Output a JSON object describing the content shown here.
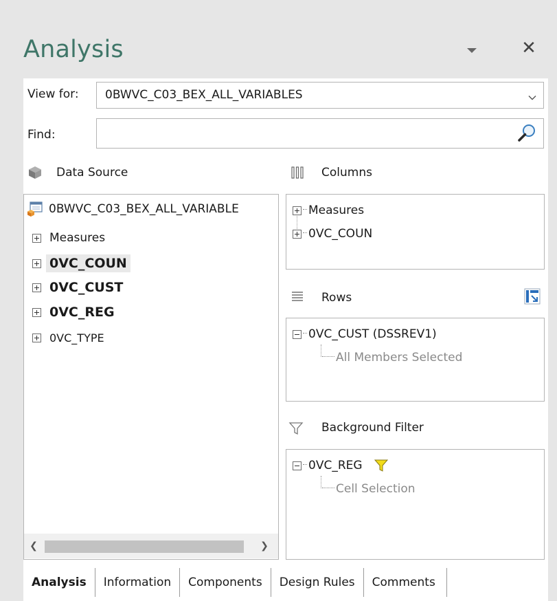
{
  "pane": {
    "title": "Analysis",
    "menu_icon": "dropdown-triangle-icon",
    "close_icon": "close-x-icon"
  },
  "view_for": {
    "label": "View for:",
    "value": "0BWVC_C03_BEX_ALL_VARIABLES"
  },
  "find": {
    "label": "Find:",
    "value": "",
    "icon": "magnifier-icon"
  },
  "data_source": {
    "title": "Data Source",
    "root": "0BWVC_C03_BEX_ALL_VARIABLE",
    "items": [
      {
        "label": "Measures",
        "bold": false
      },
      {
        "label": "0VC_COUN",
        "bold": true,
        "selected": true
      },
      {
        "label": "0VC_CUST",
        "bold": true
      },
      {
        "label": "0VC_REG",
        "bold": true
      },
      {
        "label": "0VC_TYPE",
        "bold": false
      }
    ]
  },
  "columns": {
    "title": "Columns",
    "items": [
      "Measures",
      "0VC_COUN"
    ]
  },
  "rows": {
    "title": "Rows",
    "item": "0VC_CUST (DSSREV1)",
    "child": "All Members Selected"
  },
  "background_filter": {
    "title": "Background Filter",
    "item": "0VC_REG",
    "child": "Cell Selection"
  },
  "tabs": [
    {
      "label": "Analysis",
      "active": true
    },
    {
      "label": "Information",
      "active": false
    },
    {
      "label": "Components",
      "active": false
    },
    {
      "label": "Design Rules",
      "active": false
    },
    {
      "label": "Comments",
      "active": false
    }
  ],
  "colors": {
    "title": "#3f7668",
    "filter_icon": "#e8d21a",
    "swap_icon": "#2a6ebb",
    "cube_icon": "#e08a20"
  }
}
